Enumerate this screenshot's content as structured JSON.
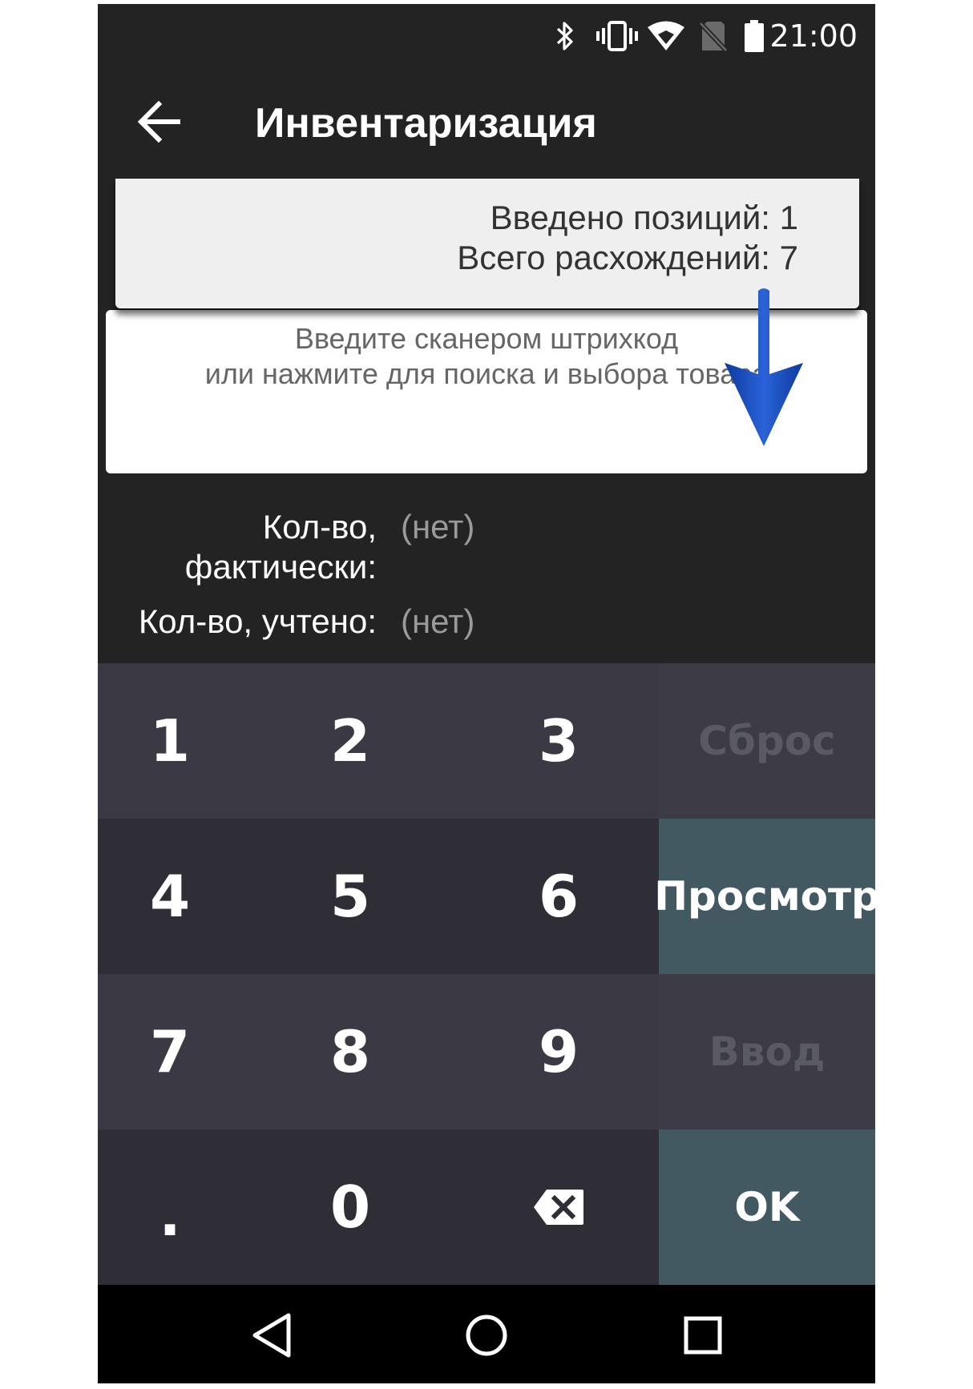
{
  "status_bar": {
    "time": "21:00",
    "icons": [
      "bluetooth-icon",
      "vibrate-icon",
      "wifi-icon",
      "no-sim-icon",
      "battery-icon"
    ]
  },
  "app_bar": {
    "title": "Инвентаризация",
    "back_icon": "arrow-left-icon"
  },
  "summary": {
    "entered_positions": "Введено позиций: 1",
    "total_discrepancies": "Всего расхождений: 7"
  },
  "search": {
    "hint_line_1": "Введите сканером штрихкод",
    "hint_line_2": "или нажмите для поиска и выбора товара"
  },
  "quantity": {
    "actual_label_1": "Кол-во,",
    "actual_label_2": "фактически:",
    "actual_value": "(нет)",
    "accounted_label": "Кол-во, учтено:",
    "accounted_value": "(нет)"
  },
  "keypad": {
    "digits": [
      "1",
      "2",
      "3",
      "4",
      "5",
      "6",
      "7",
      "8",
      "9",
      ".",
      "0"
    ],
    "backspace_icon": "backspace-icon",
    "reset_label": "Сброс",
    "view_label": "Просмотр",
    "enter_label": "Ввод",
    "ok_label": "OK"
  },
  "colors": {
    "background": "#232323",
    "keypad_row_light": "#3a3944",
    "keypad_row_dark": "#2f2e36",
    "accent_teal": "#425962",
    "overlay_arrow": "#1e4fc0"
  },
  "nav_bar": {
    "icons": [
      "nav-back-icon",
      "nav-home-icon",
      "nav-recents-icon"
    ]
  }
}
